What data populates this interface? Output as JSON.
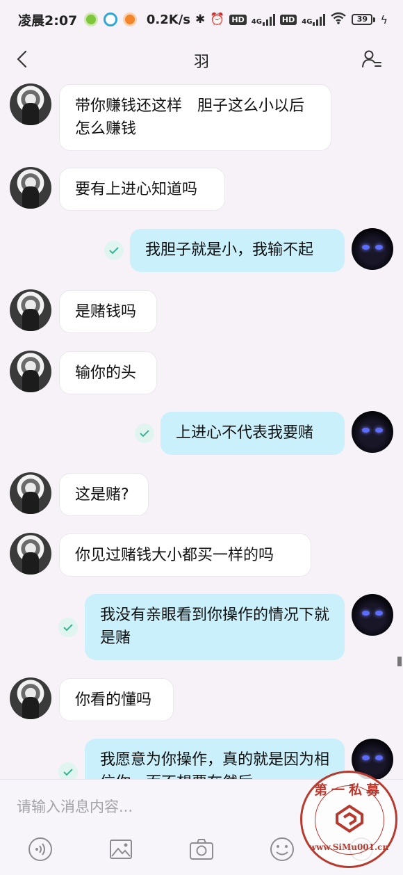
{
  "status_bar": {
    "time": "凌晨2:07",
    "net_speed": "0.2K/s",
    "hd1": "HD",
    "net1": "4G",
    "hd2": "HD",
    "net2": "4G",
    "battery": "39"
  },
  "header": {
    "title": "羽"
  },
  "messages": [
    {
      "from": "them",
      "text": "带你赚钱还这样　胆子这么小以后怎么赚钱"
    },
    {
      "from": "them",
      "text": "要有上进心知道吗"
    },
    {
      "from": "me",
      "text": "我胆子就是小，我输不起"
    },
    {
      "from": "them",
      "text": "是赌钱吗"
    },
    {
      "from": "them",
      "text": "输你的头"
    },
    {
      "from": "me",
      "text": "上进心不代表我要赌"
    },
    {
      "from": "them",
      "text": "这是赌?"
    },
    {
      "from": "them",
      "text": "你见过赌钱大小都买一样的吗"
    },
    {
      "from": "me",
      "text": "我没有亲眼看到你操作的情况下就是赌"
    },
    {
      "from": "them",
      "text": "你看的懂吗"
    },
    {
      "from": "me",
      "text": "我愿意为你操作，真的就是因为相信你，而不想要在然后..."
    }
  ],
  "input": {
    "placeholder": "请输入消息内容..."
  },
  "toolbar": {
    "icons": [
      "voice-icon",
      "image-icon",
      "camera-icon",
      "emoji-icon",
      "plus-icon"
    ]
  },
  "watermark": {
    "top_text": "第一私募",
    "url_text": "www.SiMu001.cn"
  },
  "colors": {
    "background": "#f6f2f8",
    "my_bubble": "#c9f0fb",
    "their_bubble": "#ffffff",
    "stamp": "#b83a2f"
  }
}
